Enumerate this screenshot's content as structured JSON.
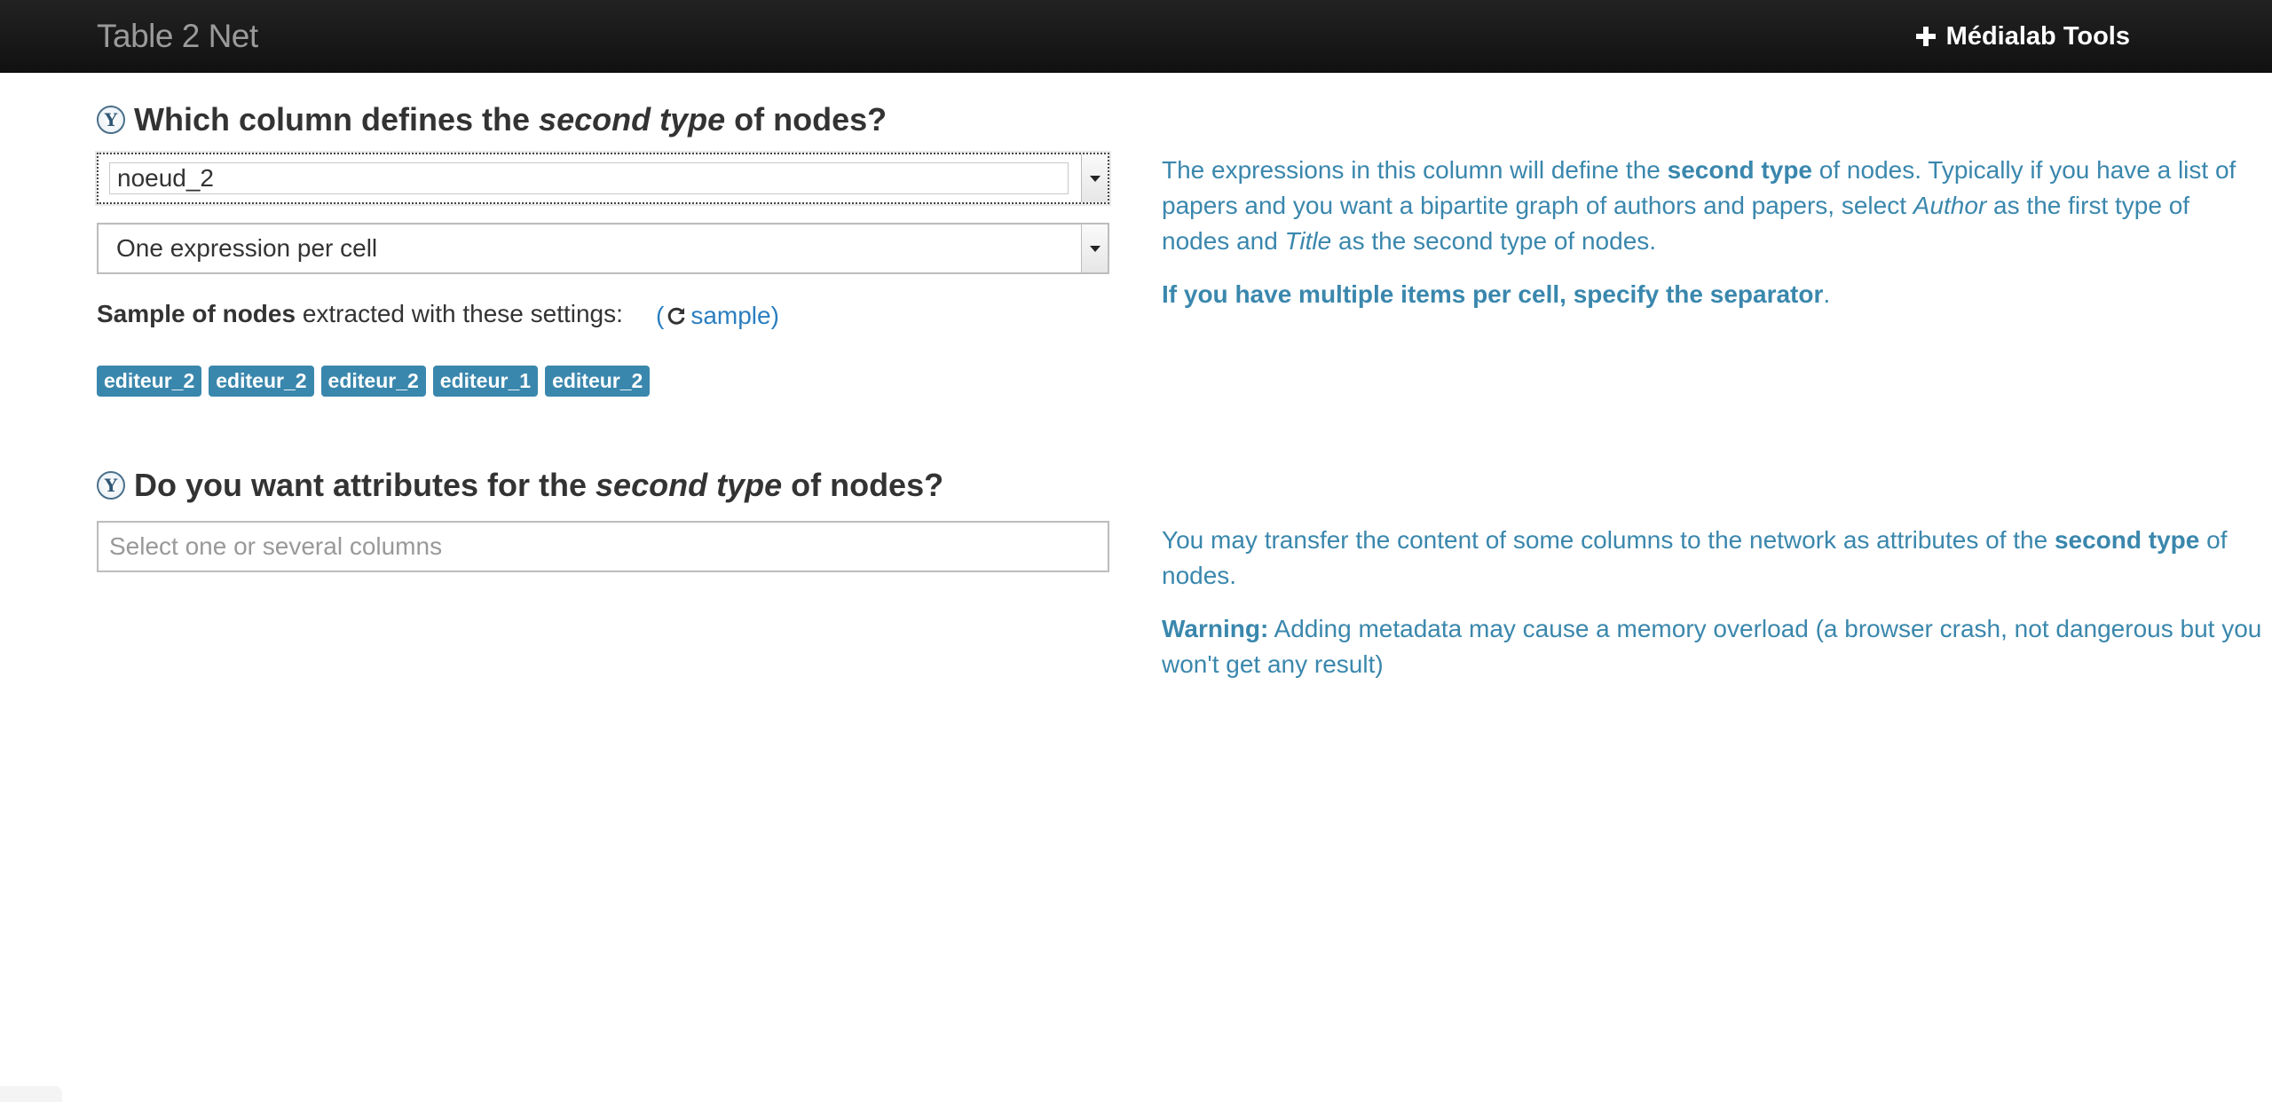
{
  "navbar": {
    "brand": "Table 2 Net",
    "tools_link": "Médialab Tools"
  },
  "section1": {
    "title_pre": "Which column defines the ",
    "title_em": "second type",
    "title_post": " of nodes?",
    "column_select_value": "noeud_2",
    "mode_select_value": "One expression per cell",
    "sample_bold": "Sample of nodes",
    "sample_rest": " extracted with these settings:",
    "sample_open_paren": "(",
    "sample_link": "sample)",
    "tags": [
      "editeur_2",
      "editeur_2",
      "editeur_2",
      "editeur_1",
      "editeur_2"
    ],
    "help": {
      "p1_a": "The expressions in this column will define the ",
      "p1_b": "second type",
      "p1_c": " of nodes. Typically if you have a list of papers and you want a bipartite graph of authors and papers, select ",
      "p1_d": "Author",
      "p1_e": " as the first type of nodes and ",
      "p1_f": "Title",
      "p1_g": " as the second type of nodes.",
      "p2_bold": "If you have multiple items per cell, specify the separator",
      "p2_end": "."
    }
  },
  "section2": {
    "title_pre": "Do you want attributes for the ",
    "title_em": "second type",
    "title_post": " of nodes?",
    "placeholder": "Select one or several columns",
    "help": {
      "p1_a": "You may transfer the content of some columns to the network as attributes of the ",
      "p1_b": "second type",
      "p1_c": " of nodes.",
      "p2_bold": "Warning:",
      "p2_rest": " Adding metadata may cause a memory overload (a browser crash, not dangerous but you won't get any result)"
    }
  },
  "icons": {
    "step": "Y",
    "tools": "plus-icon",
    "refresh": "refresh-icon",
    "dropdown": "caret-down-icon"
  },
  "colors": {
    "navbar": "#111111",
    "help_text": "#3a87ad",
    "tag_bg": "#3a87ad",
    "link": "#2a7ec0"
  }
}
